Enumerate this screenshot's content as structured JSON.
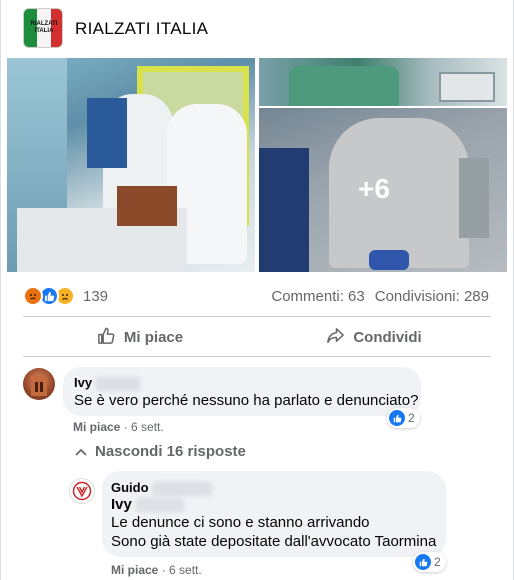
{
  "post": {
    "page_name": "RIALZATI ITALIA",
    "avatar_text": "RIALZATI ITALIA",
    "more_photos": "+6"
  },
  "stats": {
    "reaction_count": "139",
    "comments": "Commenti: 63",
    "shares": "Condivisioni: 289"
  },
  "actions": {
    "like": "Mi piace",
    "share": "Condividi"
  },
  "comments": [
    {
      "author": "Ivy",
      "text": "Se è vero perché nessuno ha parlato e denunciato?",
      "like_label": "Mi piace",
      "time": "· 6 sett.",
      "reactions": "2"
    }
  ],
  "replies_toggle": "Nascondi 16 risposte",
  "reply": {
    "author": "Guido",
    "mention": "Ivy",
    "line1": "Le denunce ci sono e stanno arrivando",
    "line2": "Sono già state depositate dall'avvocato Taormina",
    "like_label": "Mi piace",
    "time": "· 6 sett.",
    "reactions": "2"
  },
  "colors": {
    "like_blue": "#1877f2",
    "meta_gray": "#65676b",
    "bubble_bg": "#f0f2f5"
  }
}
